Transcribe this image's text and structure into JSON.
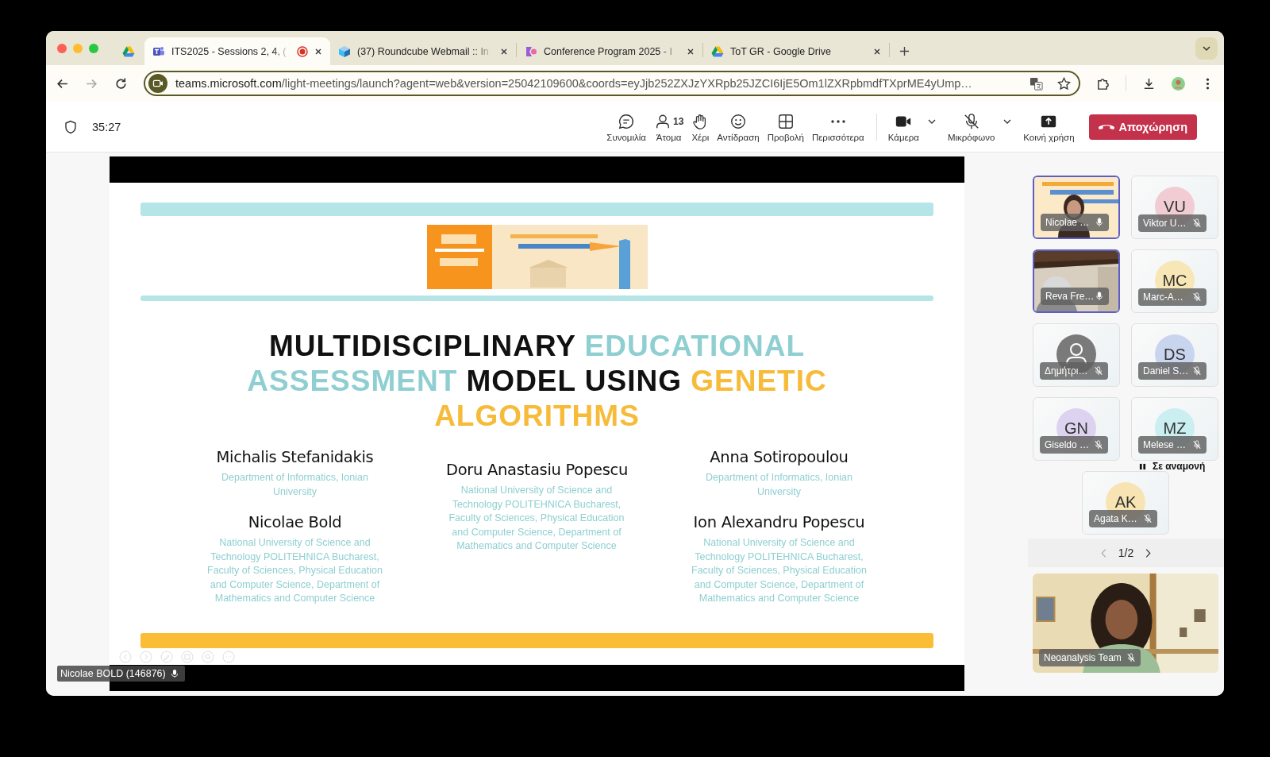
{
  "browser": {
    "tabs": [
      {
        "kind": "drive",
        "selected": false
      },
      {
        "kind": "teams",
        "title": "ITS2025 - Sessions 2, 4, (",
        "selected": true,
        "recording": true
      },
      {
        "kind": "roundcube",
        "title": "(37) Roundcube Webmail :: In",
        "selected": false,
        "recording": false
      },
      {
        "kind": "conference",
        "title": "Conference Program 2025 - I",
        "selected": false,
        "recording": false
      },
      {
        "kind": "drive",
        "title": "ToT GR - Google Drive",
        "selected": false,
        "recording": false
      }
    ],
    "address": {
      "host": "teams.microsoft.com",
      "path": "/light-meetings/launch?agent=web&version=25042109600&coords=eyJjb252ZXJzYXRpb25JZCI6IjE5Om1lZXRpbmdfTXprME4yUmp…"
    }
  },
  "meeting": {
    "timer": "35:27",
    "actions": [
      {
        "kind": "chat",
        "label": "Συνομιλία"
      },
      {
        "kind": "people",
        "label": "Άτομα",
        "count": "13"
      },
      {
        "kind": "hand",
        "label": "Χέρι"
      },
      {
        "kind": "reaction",
        "label": "Αντίδραση"
      },
      {
        "kind": "view",
        "label": "Προβολή"
      },
      {
        "kind": "more",
        "label": "Περισσότερα"
      }
    ],
    "devices": [
      {
        "kind": "camera",
        "label": "Κάμερα",
        "dropdown": true
      },
      {
        "kind": "mic",
        "label": "Μικρόφωνο",
        "dropdown": true,
        "muted": true
      },
      {
        "kind": "share",
        "label": "Κοινή χρήση",
        "dropdown": false
      }
    ],
    "leave": "Αποχώρηση"
  },
  "slide": {
    "title_lines": [
      [
        {
          "text": "MULTIDISCIPLINARY",
          "color": "#111111"
        },
        {
          "text": "EDUCATIONAL",
          "color": "#8fcfd1"
        }
      ],
      [
        {
          "text": "ASSESSMENT",
          "color": "#8fcfd1"
        },
        {
          "text": "MODEL USING",
          "color": "#111111"
        },
        {
          "text": "GENETIC",
          "color": "#f7bb3a"
        }
      ],
      [
        {
          "text": "ALGORITHMS",
          "color": "#f7bb3a"
        }
      ]
    ],
    "author_columns": [
      [
        {
          "name": "Michalis Stefanidakis",
          "affiliation": "Department of Informatics, Ionian University"
        },
        {
          "name": "Nicolae Bold",
          "affiliation": "National University of Science and Technology POLITEHNICA Bucharest, Faculty of Sciences, Physical Education and Computer Science, Department of Mathematics and Computer Science"
        }
      ],
      [
        {
          "name": "Doru Anastasiu Popescu",
          "affiliation": "National University of Science and Technology POLITEHNICA Bucharest, Faculty of Sciences, Physical Education and Computer Science, Department of Mathematics and Computer Science"
        }
      ],
      [
        {
          "name": "Anna Sotiropoulou",
          "affiliation": "Department of Informatics, Ionian University"
        },
        {
          "name": "Ion Alexandru Popescu",
          "affiliation": "National University of Science and Technology POLITEHNICA Bucharest, Faculty of Sciences, Physical Education and Computer Science, Department of Mathematics and Computer Science"
        }
      ]
    ]
  },
  "speaker_label": {
    "name": "Nicolae BOLD (146876)",
    "muted": false
  },
  "participants": {
    "tiles": [
      {
        "kind": "video",
        "name": "Nicolae …",
        "muted": false,
        "speaking": true
      },
      {
        "kind": "initials",
        "initials": "VU",
        "color": "#f1cdd3",
        "name": "Viktor U…",
        "muted": true,
        "speaking": false
      },
      {
        "kind": "video",
        "name": "Reva Fre…",
        "muted": false,
        "speaking": true
      },
      {
        "kind": "initials",
        "initials": "MC",
        "color": "#f8e7b6",
        "name": "Marc-A…",
        "muted": true,
        "speaking": false
      },
      {
        "kind": "avatar",
        "name": "Δημήτρι…",
        "muted": true,
        "speaking": false
      },
      {
        "kind": "initials",
        "initials": "DS",
        "color": "#c9d5ef",
        "name": "Daniel S…",
        "muted": true,
        "speaking": false
      },
      {
        "kind": "initials",
        "initials": "GN",
        "color": "#ddd2ef",
        "name": "Giseldo …",
        "muted": true,
        "speaking": false
      },
      {
        "kind": "initials",
        "initials": "MZ",
        "color": "#cbeef0",
        "name": "Melese …",
        "muted": true,
        "speaking": false,
        "status": "Σε αναμονή"
      },
      {
        "kind": "initials",
        "initials": "AK",
        "color": "#f8e4b3",
        "name": "Agata K…",
        "muted": true,
        "speaking": false
      }
    ],
    "pager": "1/2",
    "featured": {
      "name": "Neoanalysis Team",
      "muted": true
    }
  }
}
